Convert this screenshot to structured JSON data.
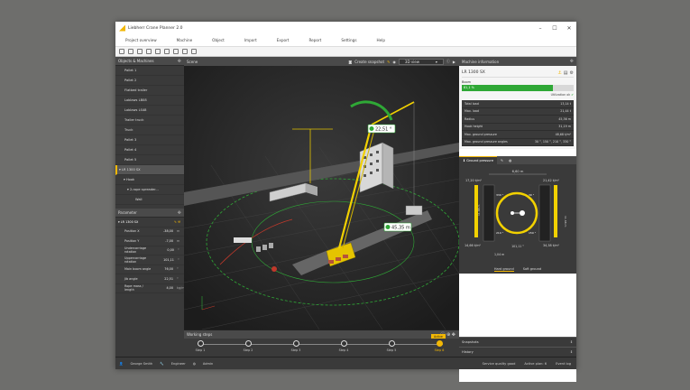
{
  "window": {
    "title": "Liebherr Crane Planner 2.0"
  },
  "menu": [
    "Project overview",
    "Machine",
    "Object",
    "Import",
    "Export",
    "Report",
    "Settings",
    "Help"
  ],
  "left_panel": {
    "title": "Objects & Machines",
    "items": [
      "Pallet 1",
      "Pallet 2",
      "Flatbed trailer",
      "Loblaws LB08",
      "Loblaws LS48",
      "Trailer truck",
      "Truck",
      "Pallet 3",
      "Pallet 4",
      "Pallet 5",
      "LR 1300 SX",
      "Hook",
      "2-rope spreader...",
      "Wall"
    ]
  },
  "parameter_panel": {
    "title": "Parameter",
    "machine": "LR 1300 SX",
    "rows": [
      {
        "label": "Position X",
        "value": "-38,00",
        "unit": "m"
      },
      {
        "label": "Position Y",
        "value": "-7,00",
        "unit": "m"
      },
      {
        "label": "Undercarriage rotation",
        "value": "0,00",
        "unit": "°"
      },
      {
        "label": "Uppercarriage rotation",
        "value": "101,11",
        "unit": "°"
      },
      {
        "label": "Main boom angle",
        "value": "76,00",
        "unit": "°"
      },
      {
        "label": "Jib angle",
        "value": "22,51",
        "unit": "°"
      },
      {
        "label": "Rope mass / length",
        "value": "4,00",
        "unit": "kg/m"
      }
    ]
  },
  "scene": {
    "title": "Scene",
    "snapshot": "Create snapshot",
    "view": "3D view",
    "angle_label": "22,51 °",
    "dist_label": "45,35 m"
  },
  "working_steps": {
    "title": "Working steps",
    "active_label": "Active",
    "steps": [
      "Step 1",
      "Step 2",
      "Step 3",
      "Step 4",
      "Step 5",
      "Step 6"
    ]
  },
  "machine_info": {
    "title": "Machine information",
    "machine": "LR 1300 SX",
    "boom_label": "Boom",
    "utilization_pct": 81.1,
    "utilization_text": "81,1 %",
    "utilization_ok": "Utilization ok",
    "rows": [
      {
        "label": "Total load",
        "value": "13,14 t"
      },
      {
        "label": "Max. load",
        "value": "21,44 t"
      },
      {
        "label": "Radius",
        "value": "45,36 m"
      },
      {
        "label": "Hook height",
        "value": "31,19 m"
      },
      {
        "label": "Max. ground pressure",
        "value": "48,68 t/m²"
      },
      {
        "label": "Max. ground pressure angles",
        "value": "30 °, 150 °, 210 °, 330 °"
      }
    ]
  },
  "ground_pressure": {
    "tab": "Ground pressure",
    "top_dim": "6,60 m",
    "left_top": "17,20 t/m²",
    "left_bot": "14,66 t/m²",
    "right_top": "21,42 t/m²",
    "right_bot": "34,38 t/m²",
    "ang_tl": "330 °",
    "ang_tr": "30 °",
    "ang_bl": "210 °",
    "ang_br": "150 °",
    "bottom_angle": "101,11 °",
    "width": "1,04 m",
    "left_dim": "11,68 m",
    "right_dim": "11,68 m",
    "footer": [
      "Hard ground",
      "Soft ground"
    ]
  },
  "collapsed": [
    "Snapshots",
    "History"
  ],
  "status": {
    "user": "George Smith",
    "role": "Engineer",
    "language": "Admin",
    "service": "Service quality good",
    "active_plan": "Active plan: 6",
    "event": "Event log"
  }
}
